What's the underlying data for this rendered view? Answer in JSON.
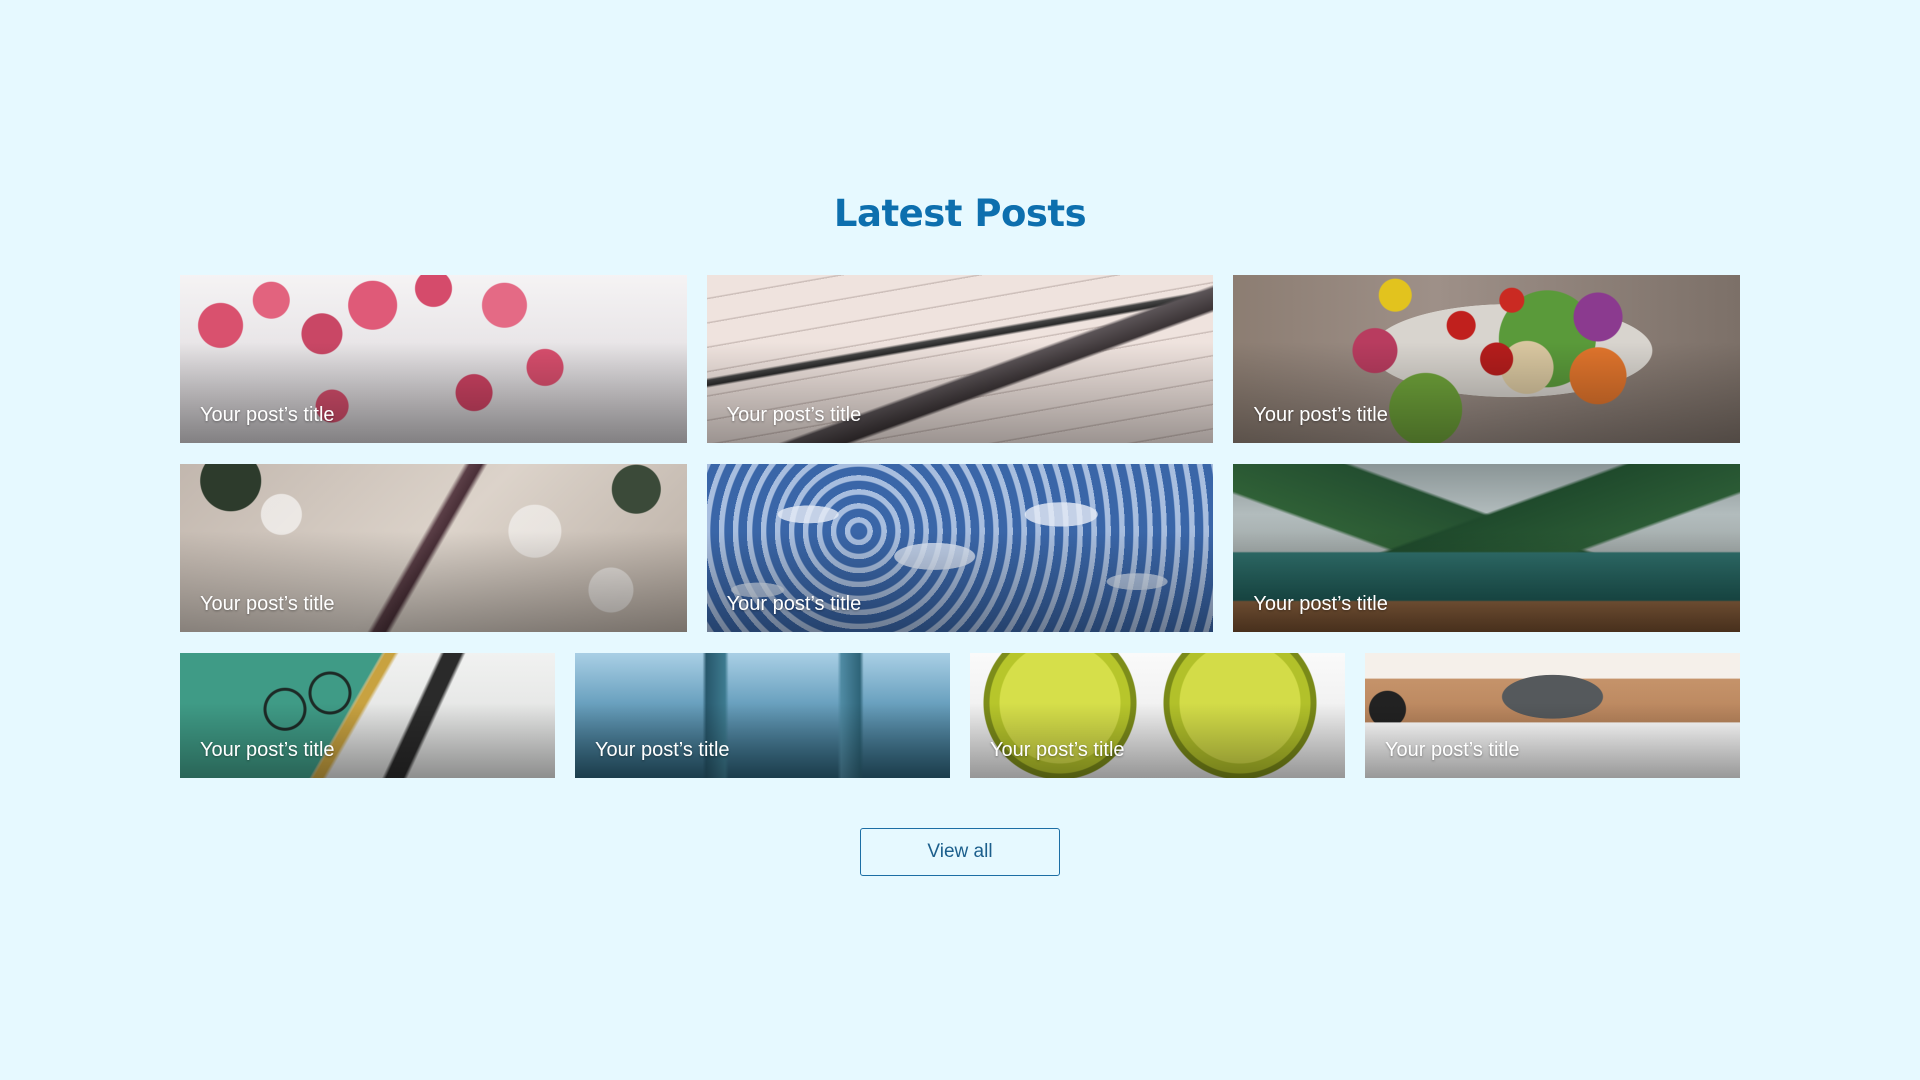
{
  "section": {
    "heading": "Latest Posts",
    "posts": [
      {
        "title": "Your post’s title",
        "image": "pink-dogwood-flowers"
      },
      {
        "title": "Your post’s title",
        "image": "fountain-pen-notebook"
      },
      {
        "title": "Your post’s title",
        "image": "salad-bowl"
      },
      {
        "title": "Your post’s title",
        "image": "snowy-branch-bokeh"
      },
      {
        "title": "Your post’s title",
        "image": "blue-cloud-sky"
      },
      {
        "title": "Your post’s title",
        "image": "mountain-lake-boat"
      },
      {
        "title": "Your post’s title",
        "image": "notebook-glasses-pencil"
      },
      {
        "title": "Your post’s title",
        "image": "icicles"
      },
      {
        "title": "Your post’s title",
        "image": "lime-halves"
      },
      {
        "title": "Your post’s title",
        "image": "desk-laptop"
      }
    ],
    "view_all_label": "View all"
  },
  "colors": {
    "background": "#e6f9ff",
    "heading": "#0d6fae",
    "button_border": "#1c6ea4"
  }
}
